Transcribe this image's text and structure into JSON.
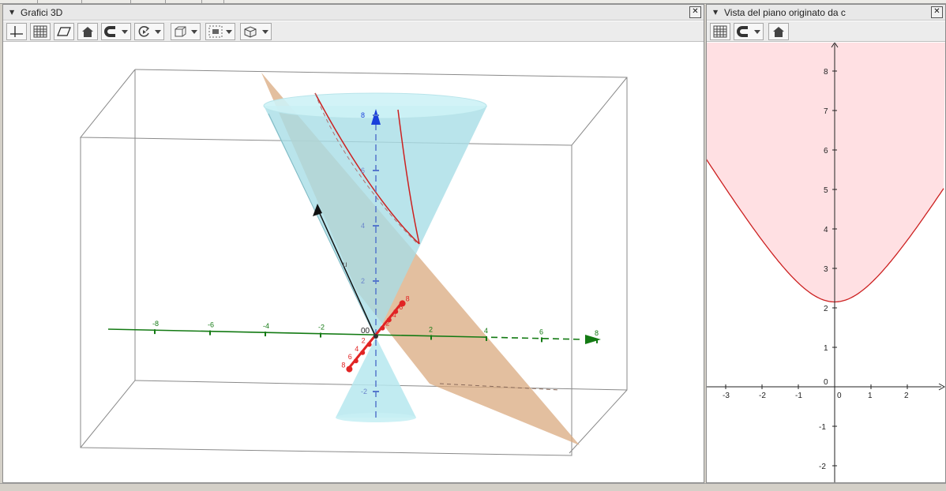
{
  "panels": {
    "view3d": {
      "title": "Grafici 3D"
    },
    "plane": {
      "title": "Vista del piano originato da c"
    }
  },
  "icons": {
    "close": "close-icon",
    "collapse": "triangle-down-icon",
    "view3d_toolbar": [
      "axes-icon",
      "grid-icon",
      "plane-icon",
      "home-icon",
      "magnet-icon",
      "rotate-icon",
      "box-icon",
      "clipping-icon",
      "view-direction-icon"
    ],
    "plane_toolbar": [
      "grid-icon",
      "magnet-icon",
      "home-icon"
    ]
  },
  "axes3d": {
    "x_ticks": [
      "-8",
      "-6",
      "-4",
      "-2",
      "2",
      "4",
      "6",
      "8"
    ],
    "z_ticks": [
      "8",
      "6",
      "4",
      "2",
      "-2"
    ],
    "y_ticks": [
      "2",
      "4",
      "6",
      "8",
      "2",
      "4",
      "6",
      "8"
    ],
    "origin_label": "00",
    "vector_label": "u"
  },
  "axes2d": {
    "x_ticks": [
      "-3",
      "-2",
      "-1",
      "0",
      "1",
      "2"
    ],
    "y_ticks": [
      "8",
      "7",
      "6",
      "5",
      "4",
      "3",
      "2",
      "1",
      "0",
      "-1",
      "-2"
    ]
  },
  "colors": {
    "x_axis": "#137a13",
    "y_axis": "#e12424",
    "z_axis": "#1a3fdb",
    "cone": "#a7dde6",
    "plane": "#d9a97f",
    "curve": "#cc2020",
    "region": "#ffe0e3"
  }
}
